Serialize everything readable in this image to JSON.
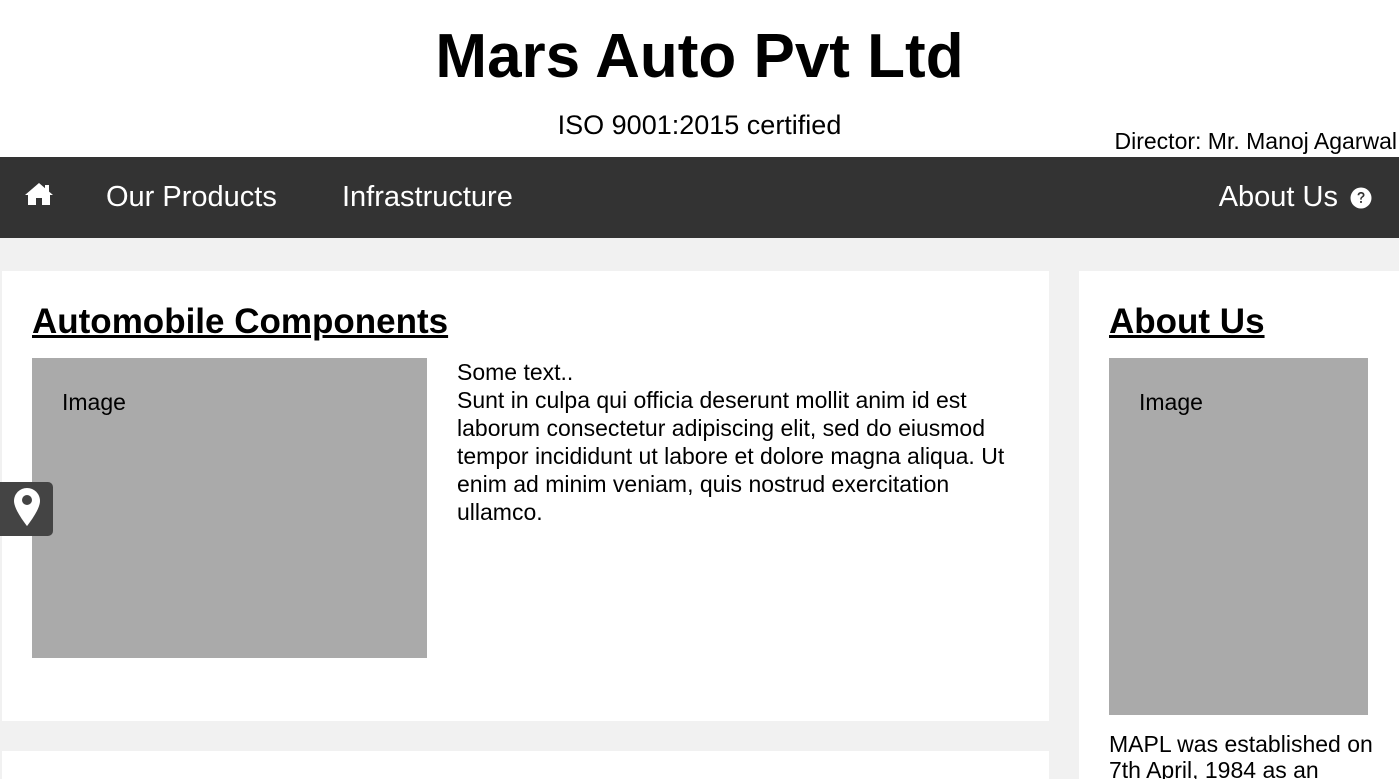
{
  "header": {
    "title": "Mars Auto Pvt Ltd",
    "subtitle": "ISO 9001:2015 certified",
    "director": "Director: Mr. Manoj Agarwal"
  },
  "nav": {
    "home_icon": "home-icon",
    "products": "Our Products",
    "infrastructure": "Infrastructure",
    "about": "About Us",
    "about_icon": "question-circle-icon",
    "background": "#333333"
  },
  "main_card": {
    "heading": "Automobile Components",
    "image_label": "Image",
    "text_intro": "Some text..",
    "text_body": "Sunt in culpa qui officia deserunt mollit anim id est laborum consectetur adipiscing elit, sed do eiusmod tempor incididunt ut labore et dolore magna aliqua. Ut enim ad minim veniam, quis nostrud exercitation ullamco."
  },
  "side_card": {
    "heading": "About Us",
    "image_label": "Image",
    "text": "MAPL was established on 7th April, 1984 as an"
  },
  "floating": {
    "map_icon": "map-marker-icon"
  },
  "colors": {
    "page_bg": "#f1f1f1",
    "card_bg": "#ffffff",
    "image_placeholder": "#aaaaaa",
    "nav_text": "#ffffff"
  }
}
